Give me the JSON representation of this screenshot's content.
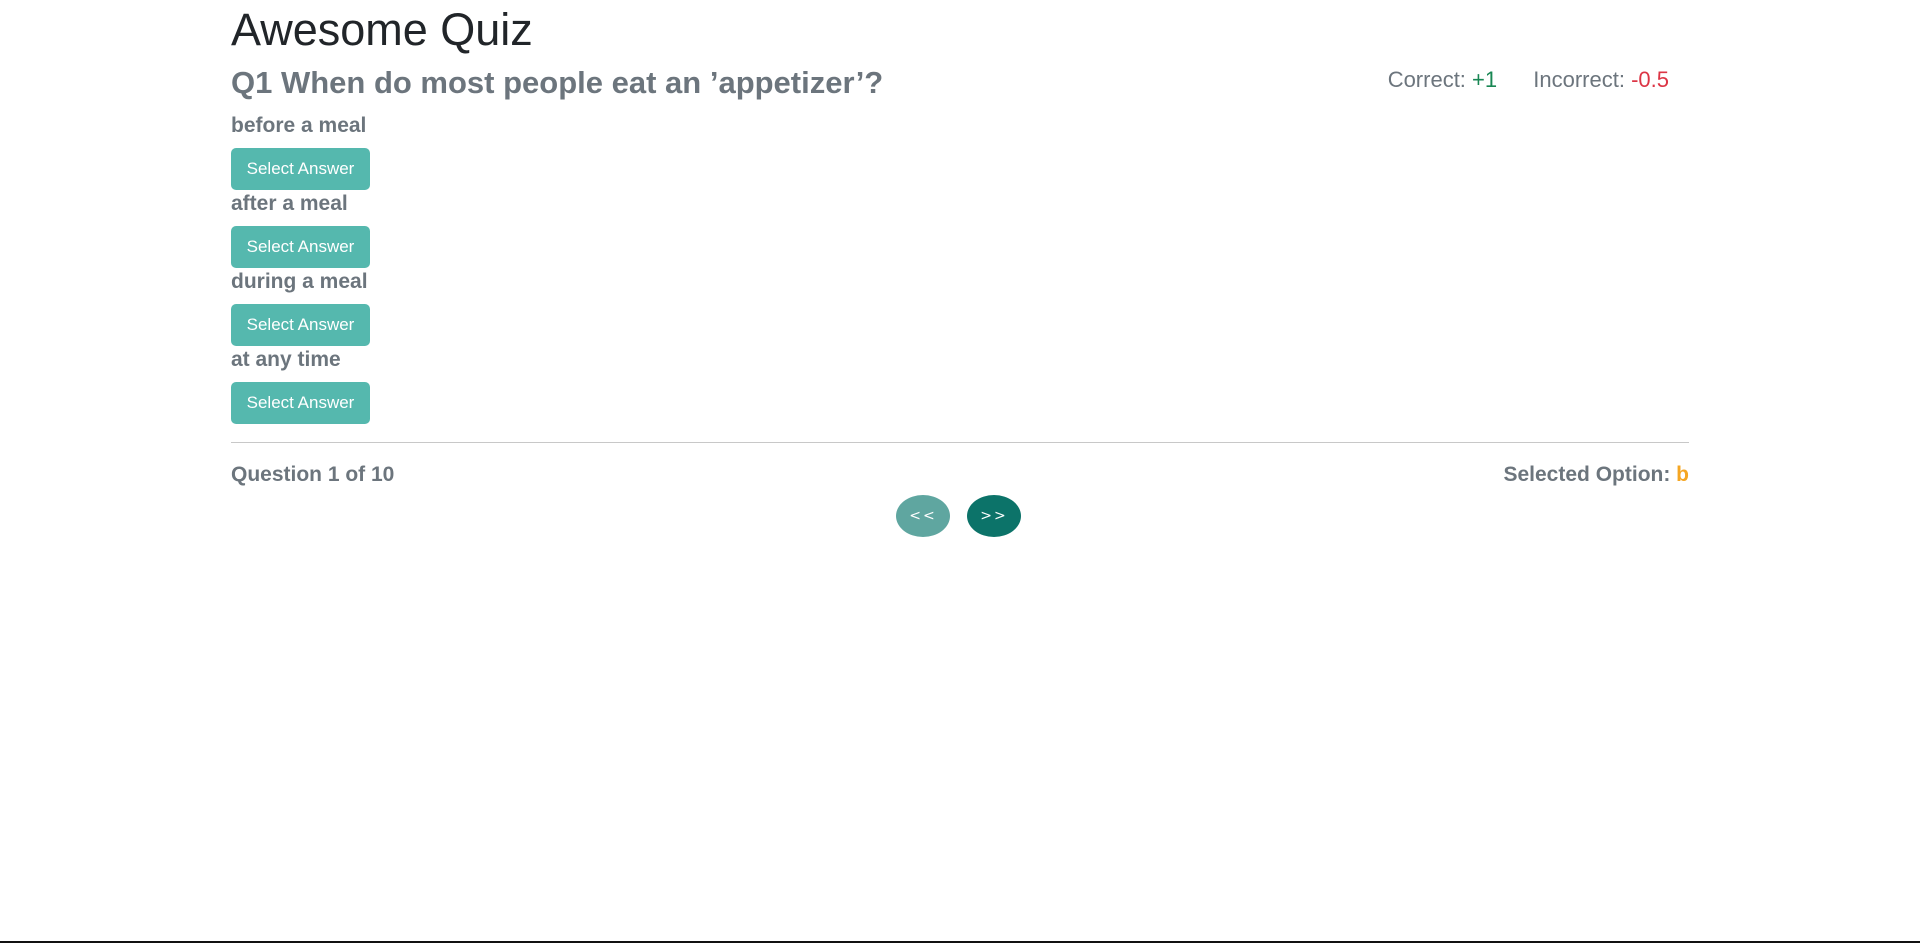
{
  "quiz": {
    "title": "Awesome Quiz",
    "question": "Q1 When do most people eat an ’appetizer’?"
  },
  "scoring": {
    "correct_label": "Correct: ",
    "correct_value": "+1",
    "incorrect_label": "Incorrect: ",
    "incorrect_value": "-0.5"
  },
  "options": [
    {
      "text": "before a meal",
      "button_label": "Select Answer"
    },
    {
      "text": "after a meal",
      "button_label": "Select Answer"
    },
    {
      "text": "during a meal",
      "button_label": "Select Answer"
    },
    {
      "text": "at any time",
      "button_label": "Select Answer"
    }
  ],
  "footer": {
    "progress": "Question 1 of 10",
    "selected_label": "Selected Option: ",
    "selected_value": "b"
  },
  "navigation": {
    "prev_label": "<<",
    "next_label": ">>"
  },
  "colors": {
    "select_button": "#55b8ae",
    "prev_button": "#5fa6a0",
    "next_button": "#0c7369",
    "correct": "#198754",
    "incorrect": "#dc3545",
    "selected_option": "#f5a623"
  }
}
